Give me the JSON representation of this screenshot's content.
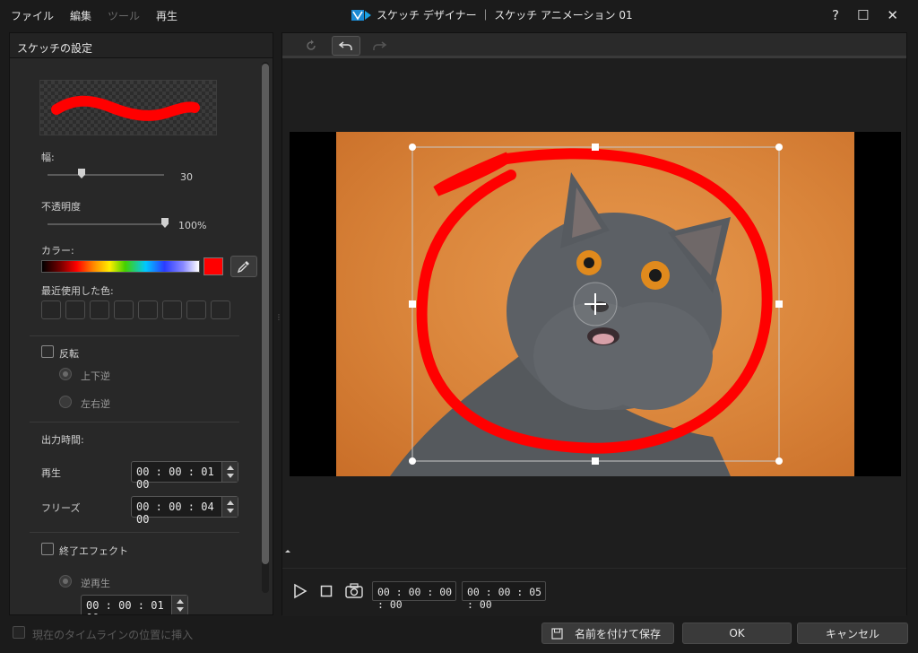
{
  "menu": {
    "file": "ファイル",
    "edit": "編集",
    "tools": "ツール",
    "play": "再生"
  },
  "window": {
    "title": "スケッチ デザイナー ｜ スケッチ アニメーション 01"
  },
  "left": {
    "header": "スケッチの設定",
    "width_label": "幅:",
    "width_value": "30",
    "opacity_label": "不透明度",
    "opacity_value": "100%",
    "color_label": "カラー:",
    "current_color": "#ff0000",
    "recent_label": "最近使用した色:",
    "flip_label": "反転",
    "flip_vertical": "上下逆",
    "flip_horizontal": "左右逆",
    "output_label": "出力時間:",
    "play_label": "再生",
    "play_time": "00 : 00 : 01 : 00",
    "freeze_label": "フリーズ",
    "freeze_time": "00 : 00 : 04 : 00",
    "end_effect_label": "終了エフェクト",
    "reverse_label": "逆再生",
    "reverse_time": "00 : 00 : 01 : 00"
  },
  "player": {
    "current_time": "00 : 00 : 00 : 00",
    "total_time": "00 : 00 : 05 : 00"
  },
  "bottom": {
    "insert_label": "現在のタイムラインの位置に挿入",
    "save_as": "名前を付けて保存",
    "ok": "OK",
    "cancel": "キャンセル"
  },
  "colors": {
    "accent": "#e8770f",
    "stroke": "#ff0000"
  }
}
